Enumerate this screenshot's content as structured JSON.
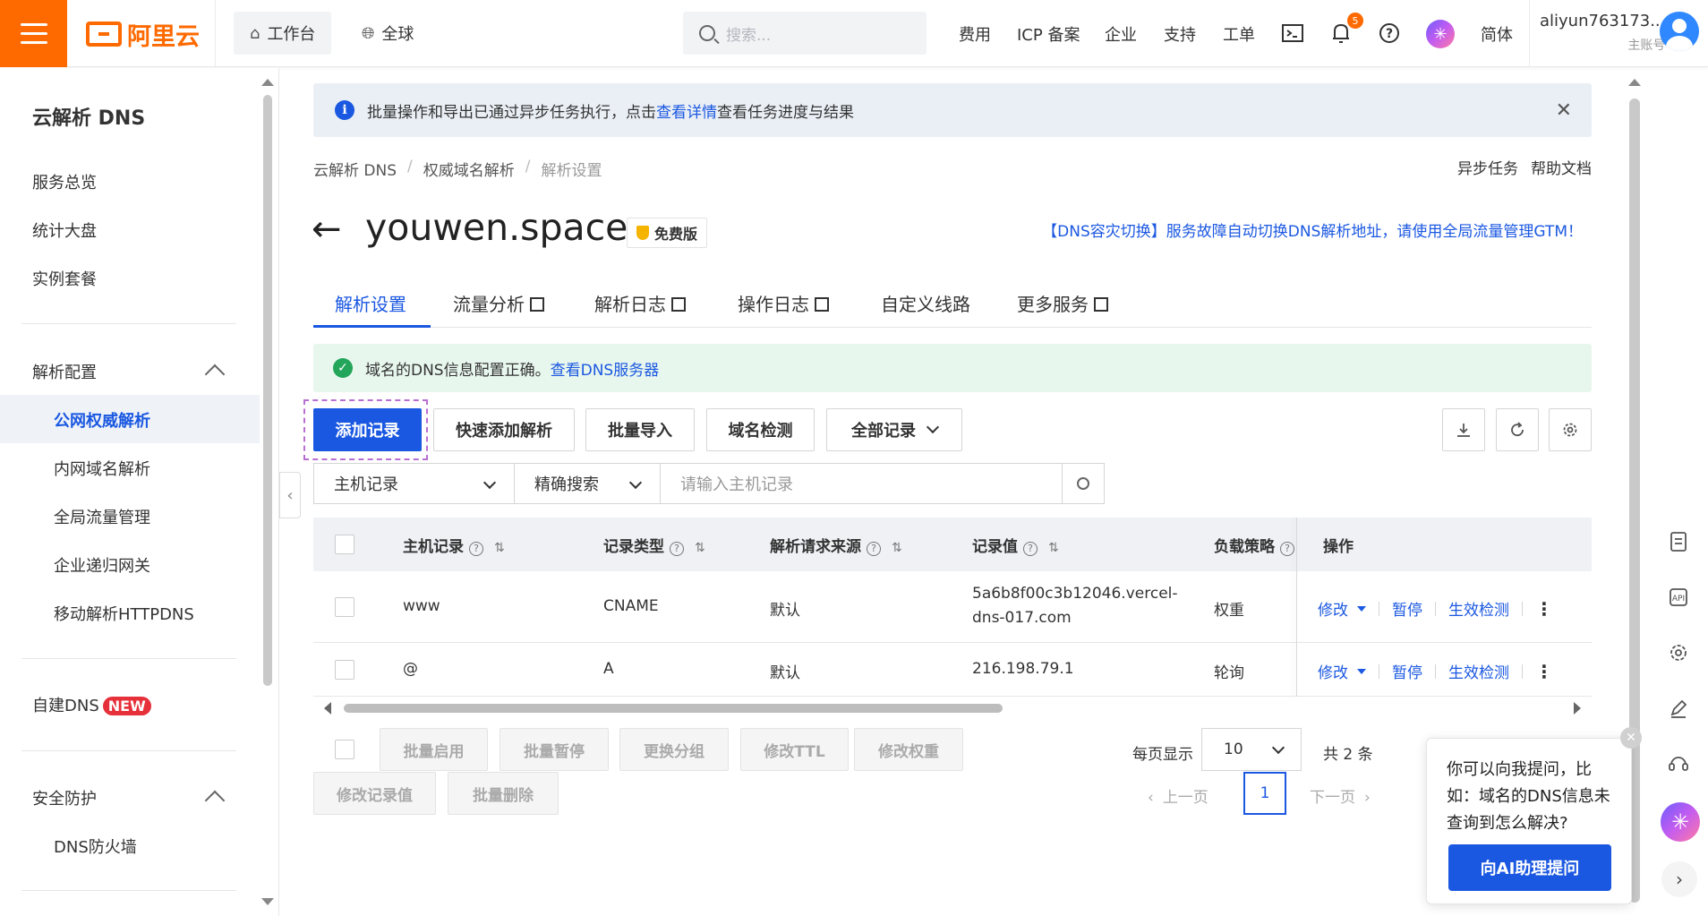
{
  "topbar": {
    "logo_text": "阿里云",
    "workspace_label": "工作台",
    "global_label": "全球",
    "search_placeholder": "搜索...",
    "nav": [
      "费用",
      "ICP 备案",
      "企业",
      "支持",
      "工单"
    ],
    "bell_count": "5",
    "lang_label": "简体",
    "account_name": "aliyun763173...",
    "account_sub": "主账号"
  },
  "sidebar": {
    "title": "云解析 DNS",
    "items": [
      "服务总览",
      "统计大盘",
      "实例套餐"
    ],
    "group_resolve": "解析配置",
    "resolve_items": [
      "公网权威解析",
      "内网域名解析",
      "全局流量管理",
      "企业递归网关",
      "移动解析HTTPDNS"
    ],
    "self_dns": "自建DNS",
    "new_badge": "NEW",
    "group_security": "安全防护",
    "security_items": [
      "DNS防火墙"
    ]
  },
  "notice": {
    "text_before": "批量操作和导出已通过异步任务执行，点击",
    "link": "查看详情",
    "text_after": "查看任务进度与结果"
  },
  "breadcrumb": [
    "云解析 DNS",
    "权威域名解析",
    "解析设置"
  ],
  "top_links": [
    "异步任务",
    "帮助文档"
  ],
  "domain": {
    "name": "youwen.space",
    "badge": "免费版",
    "gtm_link": "【DNS容灾切换】服务故障自动切换DNS解析地址，请使用全局流量管理GTM！"
  },
  "tabs": [
    "解析设置",
    "流量分析",
    "解析日志",
    "操作日志",
    "自定义线路",
    "更多服务"
  ],
  "success": {
    "text": "域名的DNS信息配置正确。",
    "link": "查看DNS服务器"
  },
  "toolbar": {
    "add": "添加记录",
    "quick_add": "快速添加解析",
    "batch_import": "批量导入",
    "domain_check": "域名检测",
    "all_records": "全部记录"
  },
  "filter": {
    "field": "主机记录",
    "mode": "精确搜索",
    "placeholder": "请输入主机记录"
  },
  "table": {
    "headers": [
      "主机记录",
      "记录类型",
      "解析请求来源",
      "记录值",
      "负载策略",
      "操作"
    ],
    "rows": [
      {
        "host": "www",
        "type": "CNAME",
        "source": "默认",
        "value_1": "5a6b8f00c3b12046.vercel-",
        "value_2": "dns-017.com",
        "policy": "权重"
      },
      {
        "host": "@",
        "type": "A",
        "source": "默认",
        "value_1": "216.198.79.1",
        "value_2": "",
        "policy": "轮询"
      }
    ],
    "ops": {
      "edit": "修改",
      "pause": "暂停",
      "check": "生效检测"
    }
  },
  "batch": [
    "批量启用",
    "批量暂停",
    "更换分组",
    "修改TTL",
    "修改权重",
    "修改记录值",
    "批量删除"
  ],
  "pagination": {
    "size_label": "每页显示",
    "size": "10",
    "total": "共 2 条",
    "prev": "上一页",
    "current": "1",
    "next": "下一页"
  },
  "ai_popup": {
    "text": "你可以向我提问，比如：域名的DNS信息未查询到怎么解决?",
    "cta": "向AI助理提问"
  }
}
